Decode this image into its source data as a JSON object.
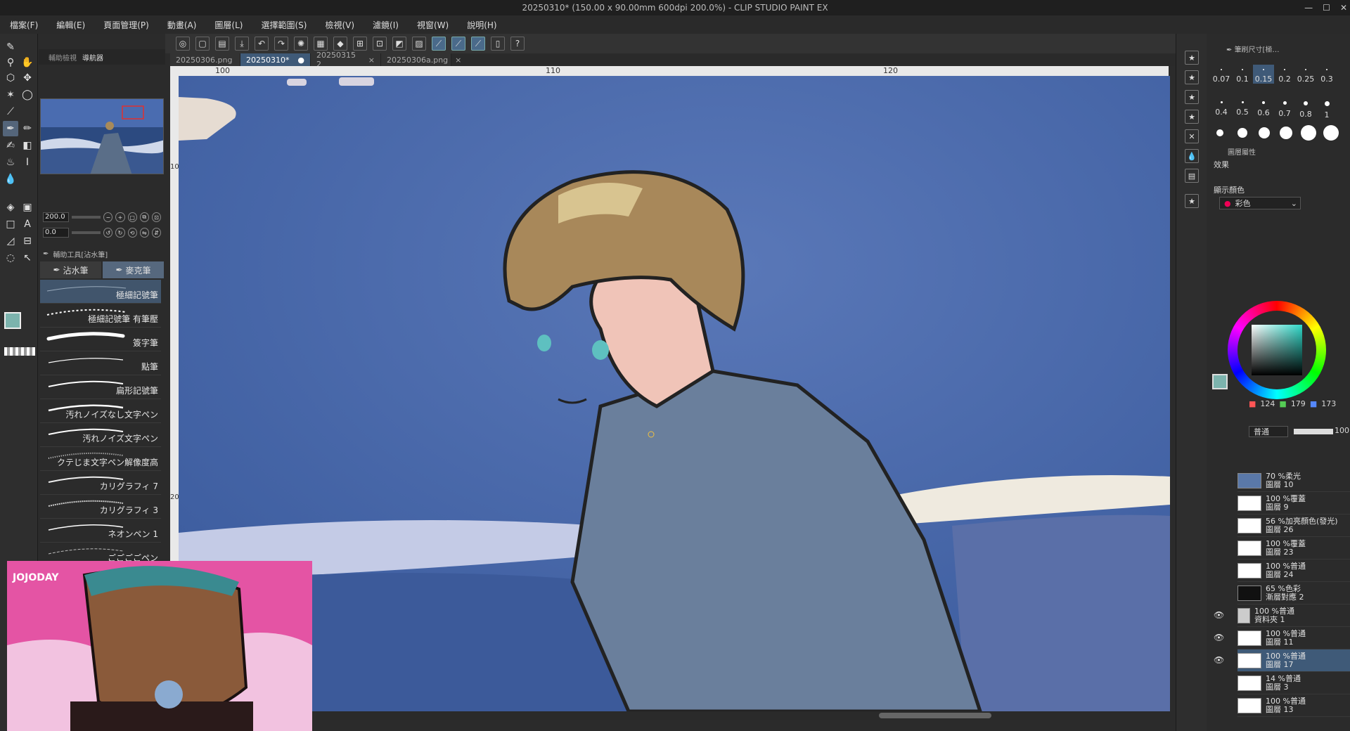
{
  "window": {
    "title": "20250310* (150.00 x 90.00mm 600dpi 200.0%) - CLIP STUDIO PAINT EX",
    "controls": [
      "—",
      "☐",
      "✕"
    ]
  },
  "menu": [
    "檔案(F)",
    "編輯(E)",
    "頁面管理(P)",
    "動畫(A)",
    "圖層(L)",
    "選擇範圍(S)",
    "檢視(V)",
    "濾鏡(I)",
    "視窗(W)",
    "說明(H)"
  ],
  "tabs": [
    {
      "label": "20250306.png",
      "close": "×"
    },
    {
      "label": "20250310*",
      "close": "●"
    },
    {
      "label": "20250315 2",
      "close": "×"
    },
    {
      "label": "20250306a.png",
      "close": "×"
    }
  ],
  "ruler": {
    "h_labels": [
      "100",
      "110",
      "120"
    ],
    "v_labels": [
      "10",
      "20"
    ]
  },
  "left_panel": {
    "tab_a": "輔助檢視",
    "tab_b": "導航器",
    "zoom_value": "200.0",
    "rotate_value": "0.0",
    "subtool_header": "輔助工具[沾水筆]",
    "subtool_tabs": [
      "沾水筆",
      "麥克筆"
    ],
    "brushes": [
      "極細記號筆",
      "極細記號筆 有筆壓",
      "簽字筆",
      "點筆",
      "扁形記號筆",
      "汚れノイズなし文字ペン",
      "汚れノイズ文字ペン",
      "クテじま文字ペン解像度高",
      "カリグラフィ 7",
      "カリグラフィ 3",
      "ネオンペン 1",
      "ごごごごペン"
    ]
  },
  "right_panel": {
    "brush_size_title": "筆刷尺寸[極…",
    "sizes": [
      "0.07",
      "0.1",
      "0.15",
      "0.2",
      "0.25",
      "0.3",
      "0.4",
      "0.5",
      "0.6",
      "0.7",
      "0.8",
      "1"
    ],
    "layer_prop_title": "圖層屬性",
    "effect_label": "效果",
    "display_color_label": "顯示顏色",
    "display_color_value": "彩色",
    "rgb": {
      "r": "124",
      "g": "179",
      "b": "173"
    },
    "blend_mode": "普通",
    "opacity": "100",
    "layers": [
      {
        "line1": "70 %柔光",
        "line2": "圖層 10"
      },
      {
        "line1": "100 %覆蓋",
        "line2": "圖層 9"
      },
      {
        "line1": "56 %加亮顏色(發光)",
        "line2": "圖層 26"
      },
      {
        "line1": "100 %覆蓋",
        "line2": "圖層 23"
      },
      {
        "line1": "100 %普通",
        "line2": "圖層 24"
      },
      {
        "line1": "65 %色彩",
        "line2": "漸層對應 2"
      },
      {
        "line1": "100 %普通",
        "line2": "資料夾 1"
      },
      {
        "line1": "100 %普通",
        "line2": "圖層 11"
      },
      {
        "line1": "100 %普通",
        "line2": "圖層 17"
      },
      {
        "line1": "14 %普通",
        "line2": "圖層 3"
      },
      {
        "line1": "100 %普通",
        "line2": "圖層 13"
      }
    ]
  },
  "colors": {
    "accent": "#3f5a78",
    "main_color": "#7cb3ad",
    "sky": "#4a68a8"
  }
}
